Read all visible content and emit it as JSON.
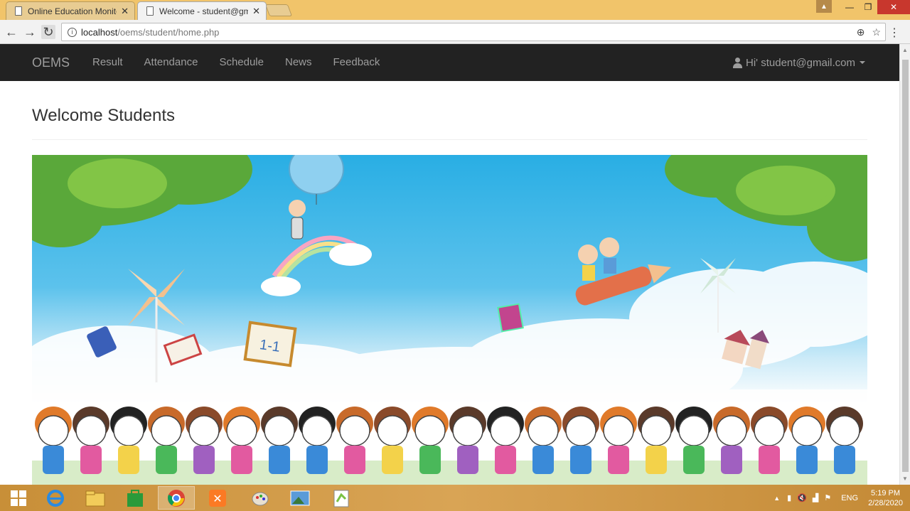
{
  "browser": {
    "tabs": [
      {
        "title": "Online Education Monito",
        "active": false
      },
      {
        "title": "Welcome - student@gm",
        "active": true
      }
    ],
    "url_host": "localhost",
    "url_path": "/oems/student/home.php"
  },
  "navbar": {
    "brand": "OEMS",
    "links": [
      "Result",
      "Attendance",
      "Schedule",
      "News",
      "Feedback"
    ],
    "user_label": "Hi' student@gmail.com"
  },
  "page": {
    "title": "Welcome Students",
    "banner_text": "1-1"
  },
  "taskbar": {
    "language": "ENG",
    "time": "5:19 PM",
    "date": "2/28/2020"
  },
  "colors": {
    "navbar_bg": "#222222",
    "nav_text": "#9d9d9d",
    "sky": "#29aee4",
    "taskbar": "#d9a455"
  }
}
